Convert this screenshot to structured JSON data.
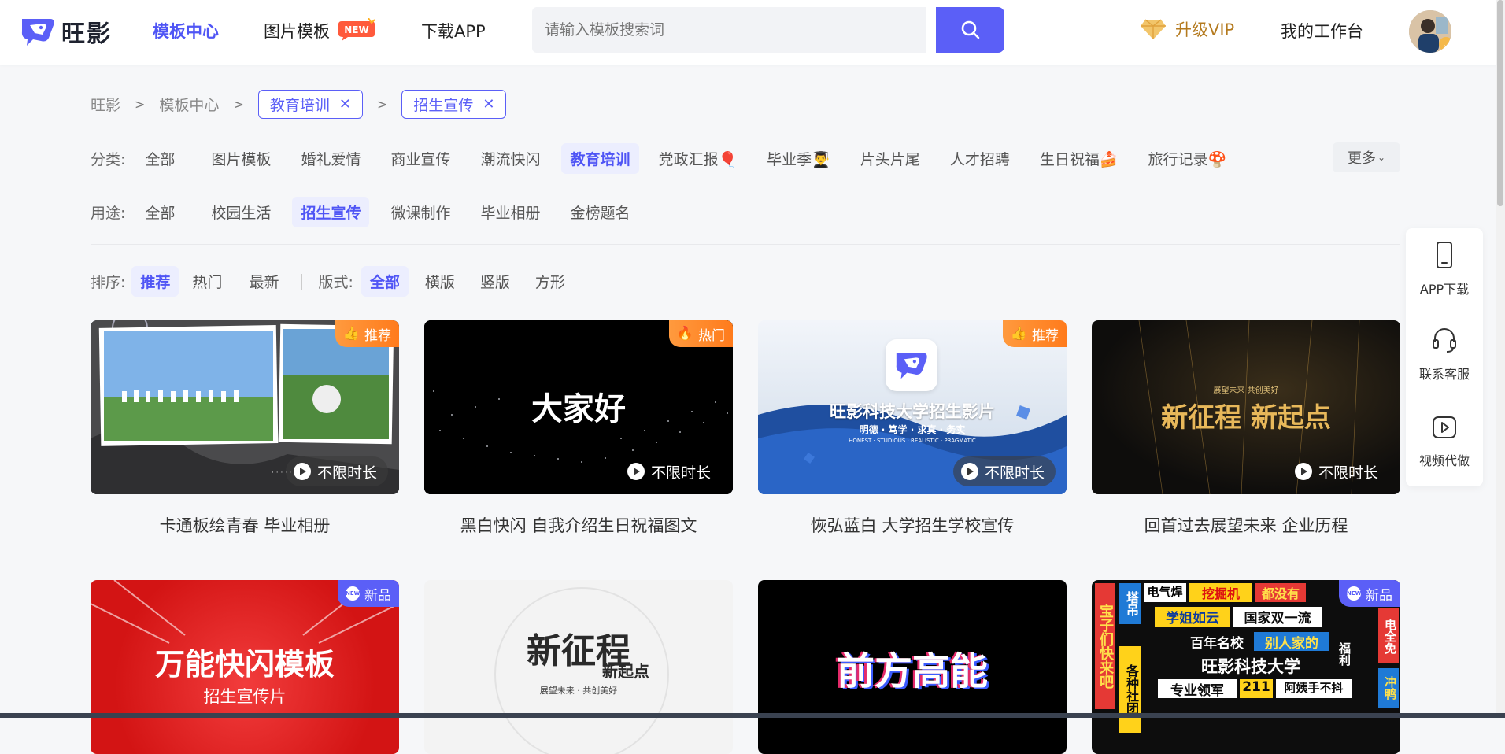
{
  "header": {
    "logo_text": "旺影",
    "nav": [
      "模板中心",
      "图片模板",
      "下载APP"
    ],
    "new_badge": "NEW",
    "search_placeholder": "请输入模板搜索词",
    "vip_label": "升级VIP",
    "workspace_label": "我的工作台"
  },
  "breadcrumb": {
    "items": [
      "旺影",
      "模板中心"
    ],
    "tags": [
      "教育培训",
      "招生宣传"
    ]
  },
  "filters": {
    "category_label": "分类:",
    "categories": [
      "全部",
      "图片模板",
      "婚礼爱情",
      "商业宣传",
      "潮流快闪",
      "教育培训",
      "党政汇报🎈",
      "毕业季👨‍🎓",
      "片头片尾",
      "人才招聘",
      "生日祝福🍰",
      "旅行记录🍄"
    ],
    "category_active": "教育培训",
    "more_label": "更多",
    "usage_label": "用途:",
    "usages": [
      "全部",
      "校园生活",
      "招生宣传",
      "微课制作",
      "毕业相册",
      "金榜题名"
    ],
    "usage_active": "招生宣传",
    "sort_label": "排序:",
    "sorts": [
      "推荐",
      "热门",
      "最新"
    ],
    "sort_active": "推荐",
    "format_label": "版式:",
    "formats": [
      "全部",
      "横版",
      "竖版",
      "方形"
    ],
    "format_active": "全部"
  },
  "cards": [
    {
      "title": "卡通板绘青春 毕业相册",
      "badge": "推荐",
      "duration": "不限时长"
    },
    {
      "title": "黑白快闪 自我介绍生日祝福图文",
      "badge": "热门",
      "duration": "不限时长",
      "thumb_text": "大家好"
    },
    {
      "title": "恢弘蓝白 大学招生学校宣传",
      "badge": "推荐",
      "duration": "不限时长",
      "thumb_text": "旺影科技大学招生影片",
      "thumb_sub": "明德 · 笃学 · 求真 · 务实",
      "thumb_sub2": "HONEST · STUDIOUS · REALISTIC · PRAGMATIC"
    },
    {
      "title": "回首过去展望未来 企业历程",
      "duration": "不限时长",
      "thumb_small": "展望未来 共创美好",
      "thumb_text": "新征程 新起点"
    },
    {
      "badge": "新品",
      "thumb_text": "万能快闪模板",
      "thumb_sub": "招生宣传片"
    },
    {
      "thumb_text": "新征程",
      "thumb_sub": "新起点",
      "thumb_small": "展望未来 · 共创美好"
    },
    {
      "thumb_text": "前方高能"
    },
    {
      "badge": "新品",
      "thumb_words": [
        "宝子们快来吧",
        "塔吊",
        "电气焊",
        "挖掘机",
        "都没有",
        "学姐如云",
        "国家双一流",
        "百年名校",
        "别人家的",
        "旺影科技大学",
        "专业领军",
        "211",
        "阿姨手不抖",
        "福利",
        "电全免",
        "冲鸭",
        "各种社团"
      ]
    }
  ],
  "side_panel": [
    "APP下载",
    "联系客服",
    "视频代做"
  ],
  "colors": {
    "accent": "#5b5ff7",
    "vip": "#b47a1e",
    "badge_orange": "#ff8a2a"
  }
}
